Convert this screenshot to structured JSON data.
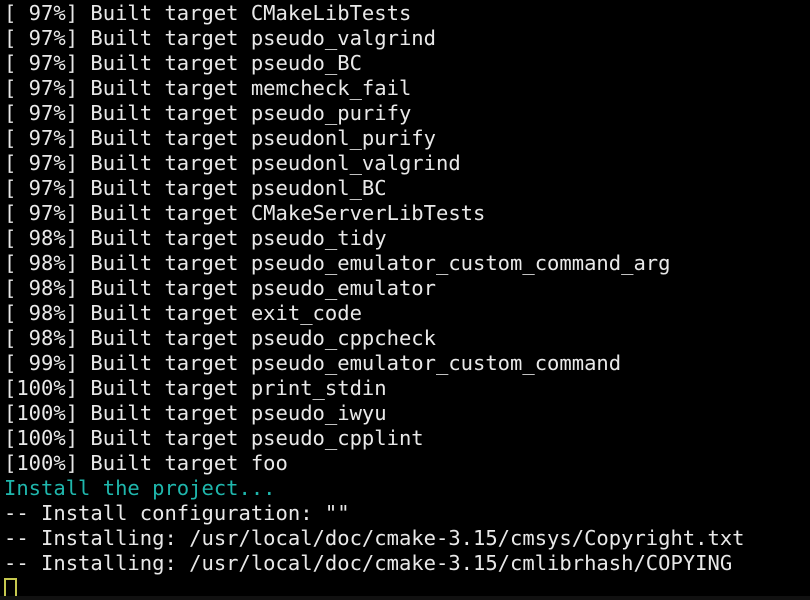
{
  "terminal": {
    "background_color": "#000000",
    "foreground_color": "#e9e9e9",
    "accent_color": "#1fb7ad",
    "cursor_color": "#c6c84f",
    "columns": 64,
    "rows": 24,
    "lines": [
      {
        "text": "[ 97%] Built target CMakeLibTests",
        "color": "white"
      },
      {
        "text": "[ 97%] Built target pseudo_valgrind",
        "color": "white"
      },
      {
        "text": "[ 97%] Built target pseudo_BC",
        "color": "white"
      },
      {
        "text": "[ 97%] Built target memcheck_fail",
        "color": "white"
      },
      {
        "text": "[ 97%] Built target pseudo_purify",
        "color": "white"
      },
      {
        "text": "[ 97%] Built target pseudonl_purify",
        "color": "white"
      },
      {
        "text": "[ 97%] Built target pseudonl_valgrind",
        "color": "white"
      },
      {
        "text": "[ 97%] Built target pseudonl_BC",
        "color": "white"
      },
      {
        "text": "[ 97%] Built target CMakeServerLibTests",
        "color": "white"
      },
      {
        "text": "[ 98%] Built target pseudo_tidy",
        "color": "white"
      },
      {
        "text": "[ 98%] Built target pseudo_emulator_custom_command_arg",
        "color": "white"
      },
      {
        "text": "[ 98%] Built target pseudo_emulator",
        "color": "white"
      },
      {
        "text": "[ 98%] Built target exit_code",
        "color": "white"
      },
      {
        "text": "[ 98%] Built target pseudo_cppcheck",
        "color": "white"
      },
      {
        "text": "[ 99%] Built target pseudo_emulator_custom_command",
        "color": "white"
      },
      {
        "text": "[100%] Built target print_stdin",
        "color": "white"
      },
      {
        "text": "[100%] Built target pseudo_iwyu",
        "color": "white"
      },
      {
        "text": "[100%] Built target pseudo_cpplint",
        "color": "white"
      },
      {
        "text": "[100%] Built target foo",
        "color": "white"
      },
      {
        "text": "Install the project...",
        "color": "cyan"
      },
      {
        "text": "-- Install configuration: \"\"",
        "color": "white"
      },
      {
        "text": "-- Installing: /usr/local/doc/cmake-3.15/cmsys/Copyright.txt",
        "color": "white"
      },
      {
        "text": "-- Installing: /usr/local/doc/cmake-3.15/cmlibrhash/COPYING",
        "color": "white"
      }
    ],
    "cursor": {
      "row": 23,
      "column": 0,
      "style": "hollow-block"
    }
  }
}
